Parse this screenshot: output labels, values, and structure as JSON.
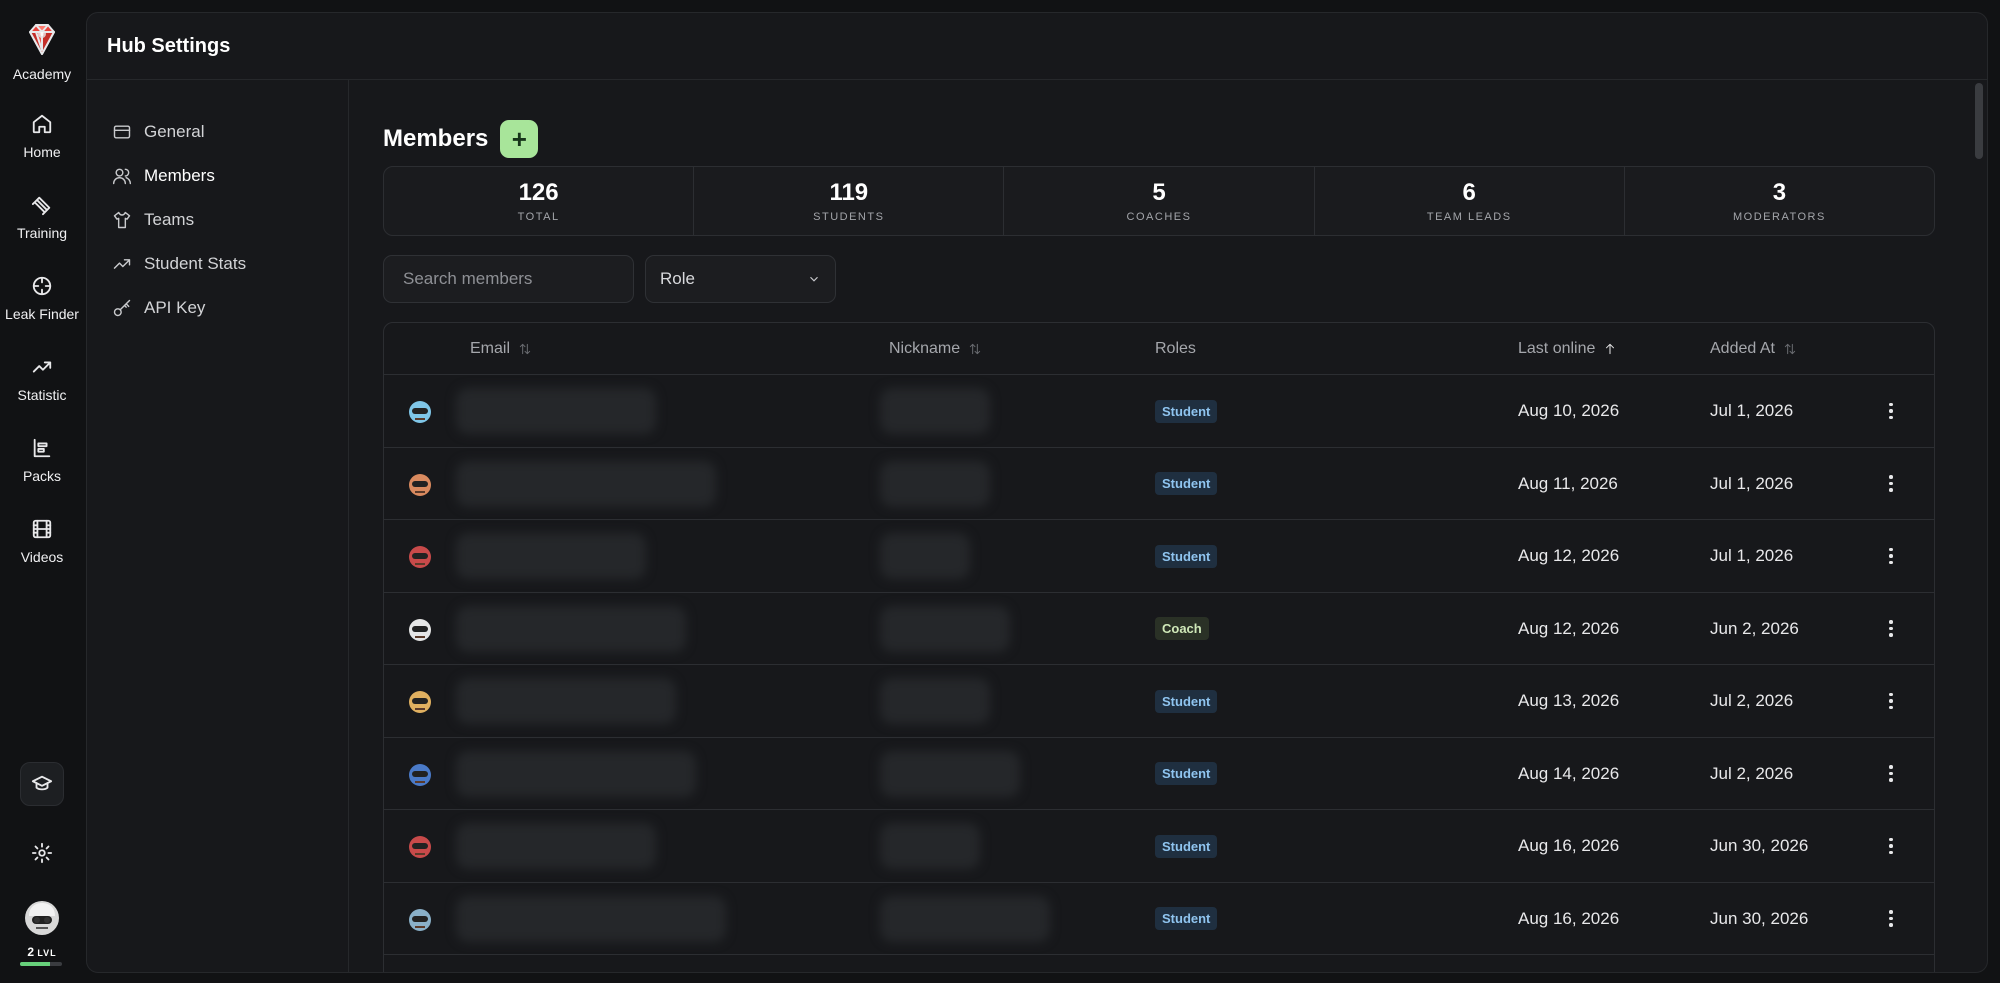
{
  "rail": {
    "brand_label": "Academy",
    "items": [
      {
        "label": "Home",
        "icon": "home-icon"
      },
      {
        "label": "Training",
        "icon": "dumbbell-icon"
      },
      {
        "label": "Leak Finder",
        "icon": "crosshair-icon"
      },
      {
        "label": "Statistic",
        "icon": "trending-up-icon"
      },
      {
        "label": "Packs",
        "icon": "packs-icon"
      },
      {
        "label": "Videos",
        "icon": "film-icon"
      }
    ],
    "level_number": "2",
    "level_suffix": "LVL",
    "level_progress": 0.72
  },
  "header": {
    "title": "Hub Settings"
  },
  "settings_nav": [
    {
      "label": "General",
      "icon": "card-icon"
    },
    {
      "label": "Members",
      "icon": "users-icon"
    },
    {
      "label": "Teams",
      "icon": "shirt-icon"
    },
    {
      "label": "Student Stats",
      "icon": "trending-up-icon"
    },
    {
      "label": "API Key",
      "icon": "key-icon"
    }
  ],
  "members": {
    "title": "Members",
    "add_label": "+",
    "stats": [
      {
        "value": "126",
        "label": "TOTAL"
      },
      {
        "value": "119",
        "label": "STUDENTS"
      },
      {
        "value": "5",
        "label": "COACHES"
      },
      {
        "value": "6",
        "label": "TEAM LEADS"
      },
      {
        "value": "3",
        "label": "MODERATORS"
      }
    ],
    "search_placeholder": "Search members",
    "role_filter": "Role",
    "columns": {
      "email": "Email",
      "nickname": "Nickname",
      "roles": "Roles",
      "last_online": "Last online",
      "added_at": "Added At"
    },
    "rows": [
      {
        "role": "Student",
        "last_online": "Aug 10, 2026",
        "added_at": "Jul 1, 2026"
      },
      {
        "role": "Student",
        "last_online": "Aug 11, 2026",
        "added_at": "Jul 1, 2026"
      },
      {
        "role": "Student",
        "last_online": "Aug 12, 2026",
        "added_at": "Jul 1, 2026"
      },
      {
        "role": "Coach",
        "last_online": "Aug 12, 2026",
        "added_at": "Jun 2, 2026"
      },
      {
        "role": "Student",
        "last_online": "Aug 13, 2026",
        "added_at": "Jul 2, 2026"
      },
      {
        "role": "Student",
        "last_online": "Aug 14, 2026",
        "added_at": "Jul 2, 2026"
      },
      {
        "role": "Student",
        "last_online": "Aug 16, 2026",
        "added_at": "Jun 30, 2026"
      },
      {
        "role": "Student",
        "last_online": "Aug 16, 2026",
        "added_at": "Jun 30, 2026"
      }
    ]
  },
  "colors": {
    "accent_green": "#a8e59a",
    "student_badge": "#8fc4ef",
    "coach_badge": "#cfe8b8",
    "brand_red": "#e8423b"
  }
}
